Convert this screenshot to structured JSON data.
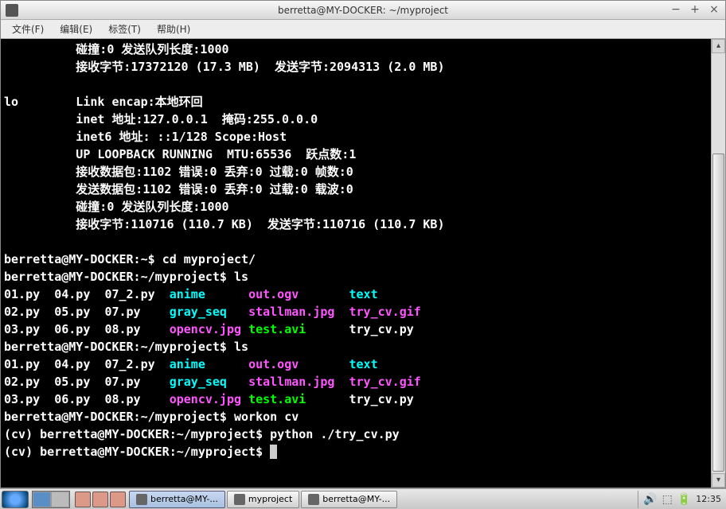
{
  "window": {
    "title": "berretta@MY-DOCKER: ~/myproject"
  },
  "menu": {
    "file": "文件(F)",
    "edit": "编辑(E)",
    "tabs": "标签(T)",
    "help": "帮助(H)"
  },
  "terminal": {
    "lines": [
      {
        "plain": "          碰撞:0 发送队列长度:1000 "
      },
      {
        "plain": "          接收字节:17372120 (17.3 MB)  发送字节:2094313 (2.0 MB)"
      },
      {
        "plain": ""
      },
      {
        "plain": "lo        Link encap:本地环回  "
      },
      {
        "plain": "          inet 地址:127.0.0.1  掩码:255.0.0.0"
      },
      {
        "plain": "          inet6 地址: ::1/128 Scope:Host"
      },
      {
        "plain": "          UP LOOPBACK RUNNING  MTU:65536  跃点数:1"
      },
      {
        "plain": "          接收数据包:1102 错误:0 丢弃:0 过载:0 帧数:0"
      },
      {
        "plain": "          发送数据包:1102 错误:0 丢弃:0 过载:0 载波:0"
      },
      {
        "plain": "          碰撞:0 发送队列长度:1000 "
      },
      {
        "plain": "          接收字节:110716 (110.7 KB)  发送字节:110716 (110.7 KB)"
      },
      {
        "plain": ""
      },
      {
        "prompt": "berretta@MY-DOCKER:~$ ",
        "cmd": "cd myproject/"
      },
      {
        "prompt": "berretta@MY-DOCKER:~/myproject$ ",
        "cmd": "ls"
      },
      {
        "ls": [
          {
            "t": "01.py",
            "c": "",
            "w": 7
          },
          {
            "t": "04.py",
            "c": "",
            "w": 7
          },
          {
            "t": "07_2.py",
            "c": "",
            "w": 9
          },
          {
            "t": "anime",
            "c": "cyan",
            "w": 11
          },
          {
            "t": "out.ogv",
            "c": "magenta",
            "w": 14
          },
          {
            "t": "text",
            "c": "cyan",
            "w": 0
          }
        ]
      },
      {
        "ls": [
          {
            "t": "02.py",
            "c": "",
            "w": 7
          },
          {
            "t": "05.py",
            "c": "",
            "w": 7
          },
          {
            "t": "07.py",
            "c": "",
            "w": 9
          },
          {
            "t": "gray_seq",
            "c": "cyan",
            "w": 11
          },
          {
            "t": "stallman.jpg",
            "c": "magenta",
            "w": 14
          },
          {
            "t": "try_cv.gif",
            "c": "magenta",
            "w": 0
          }
        ]
      },
      {
        "ls": [
          {
            "t": "03.py",
            "c": "",
            "w": 7
          },
          {
            "t": "06.py",
            "c": "",
            "w": 7
          },
          {
            "t": "08.py",
            "c": "",
            "w": 9
          },
          {
            "t": "opencv.jpg",
            "c": "magenta",
            "w": 11
          },
          {
            "t": "test.avi",
            "c": "green",
            "w": 14
          },
          {
            "t": "try_cv.py",
            "c": "",
            "w": 0
          }
        ]
      },
      {
        "prompt": "berretta@MY-DOCKER:~/myproject$ ",
        "cmd": "ls"
      },
      {
        "ls": [
          {
            "t": "01.py",
            "c": "",
            "w": 7
          },
          {
            "t": "04.py",
            "c": "",
            "w": 7
          },
          {
            "t": "07_2.py",
            "c": "",
            "w": 9
          },
          {
            "t": "anime",
            "c": "cyan",
            "w": 11
          },
          {
            "t": "out.ogv",
            "c": "magenta",
            "w": 14
          },
          {
            "t": "text",
            "c": "cyan",
            "w": 0
          }
        ]
      },
      {
        "ls": [
          {
            "t": "02.py",
            "c": "",
            "w": 7
          },
          {
            "t": "05.py",
            "c": "",
            "w": 7
          },
          {
            "t": "07.py",
            "c": "",
            "w": 9
          },
          {
            "t": "gray_seq",
            "c": "cyan",
            "w": 11
          },
          {
            "t": "stallman.jpg",
            "c": "magenta",
            "w": 14
          },
          {
            "t": "try_cv.gif",
            "c": "magenta",
            "w": 0
          }
        ]
      },
      {
        "ls": [
          {
            "t": "03.py",
            "c": "",
            "w": 7
          },
          {
            "t": "06.py",
            "c": "",
            "w": 7
          },
          {
            "t": "08.py",
            "c": "",
            "w": 9
          },
          {
            "t": "opencv.jpg",
            "c": "magenta",
            "w": 11
          },
          {
            "t": "test.avi",
            "c": "green",
            "w": 14
          },
          {
            "t": "try_cv.py",
            "c": "",
            "w": 0
          }
        ]
      },
      {
        "prompt": "berretta@MY-DOCKER:~/myproject$ ",
        "cmd": "workon cv"
      },
      {
        "prompt": "(cv) berretta@MY-DOCKER:~/myproject$ ",
        "cmd": "python ./try_cv.py "
      },
      {
        "prompt": "(cv) berretta@MY-DOCKER:~/myproject$ ",
        "cmd": "",
        "cursor": true
      }
    ]
  },
  "taskbar": {
    "items": [
      {
        "label": "berretta@MY-...",
        "active": true
      },
      {
        "label": "myproject",
        "active": false
      },
      {
        "label": "berretta@MY-...",
        "active": false
      }
    ],
    "clock": "12:35"
  }
}
